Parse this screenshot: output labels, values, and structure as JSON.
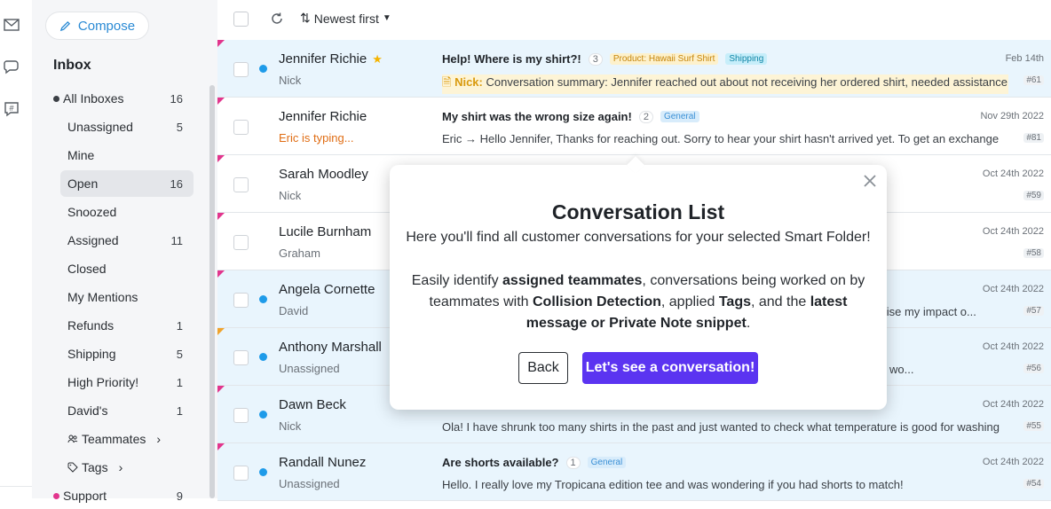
{
  "sidebar": {
    "compose_label": "Compose",
    "inbox_title": "Inbox",
    "items": [
      {
        "label": "All Inboxes",
        "count": "16"
      },
      {
        "label": "Unassigned",
        "count": "5"
      },
      {
        "label": "Mine",
        "count": ""
      },
      {
        "label": "Open",
        "count": "16"
      },
      {
        "label": "Snoozed",
        "count": ""
      },
      {
        "label": "Assigned",
        "count": "11"
      },
      {
        "label": "Closed",
        "count": ""
      },
      {
        "label": "My Mentions",
        "count": ""
      },
      {
        "label": "Refunds",
        "count": "1"
      },
      {
        "label": "Shipping",
        "count": "5"
      },
      {
        "label": "High Priority!",
        "count": "1"
      },
      {
        "label": "David's",
        "count": "1"
      },
      {
        "label": "Teammates",
        "count": ""
      },
      {
        "label": "Tags",
        "count": ""
      },
      {
        "label": "Support",
        "count": "9"
      }
    ]
  },
  "toolbar": {
    "sort_label": "Newest first"
  },
  "conversations": [
    {
      "name": "Jennifer Richie",
      "assignee": "Nick",
      "subject": "Help! Where is my shirt?!",
      "msg_count": "3",
      "tags": [
        "Product: Hawaii Surf Shirt",
        "Shipping"
      ],
      "note_author": "Nick:",
      "preview": "Conversation summary: Jennifer reached out about not receiving her ordered shirt, needed assistance",
      "date": "Feb 14th",
      "num": "#61"
    },
    {
      "name": "Jennifer Richie",
      "assignee": "Eric is typing...",
      "subject": "My shirt was the wrong size again!",
      "msg_count": "2",
      "tags": [
        "General"
      ],
      "preview": "Eric → Hello Jennifer,   Thanks for reaching out.   Sorry to hear your shirt hasn't arrived yet.  To get an exchange",
      "date": "Nov 29th 2022",
      "num": "#81"
    },
    {
      "name": "Sarah Moodley",
      "assignee": "Nick",
      "date": "Oct 24th 2022",
      "num": "#59"
    },
    {
      "name": "Lucile Burnham",
      "assignee": "Graham",
      "date": "Oct 24th 2022",
      "num": "#58"
    },
    {
      "name": "Angela Cornette",
      "assignee": "David",
      "preview_tail": "imise my impact o...",
      "date": "Oct 24th 2022",
      "num": "#57"
    },
    {
      "name": "Anthony Marshall",
      "assignee": "Unassigned",
      "preview_tail": "wo...",
      "date": "Oct 24th 2022",
      "num": "#56"
    },
    {
      "name": "Dawn Beck",
      "assignee": "Nick",
      "preview": "Ola! I have shrunk too many shirts in the past and just wanted to check what temperature is good for washing",
      "date": "Oct 24th 2022",
      "num": "#55"
    },
    {
      "name": "Randall Nunez",
      "assignee": "Unassigned",
      "subject": "Are shorts available?",
      "msg_count": "1",
      "tags": [
        "General"
      ],
      "preview": "Hello. I really love my Tropicana edition tee and was wondering if you had shorts to match!",
      "date": "Oct 24th 2022",
      "num": "#54"
    }
  ],
  "popover": {
    "title": "Conversation List",
    "line1": "Here you'll find all customer conversations for your selected Smart Folder!",
    "body_1": "Easily identify ",
    "body_b1": "assigned teammates",
    "body_2": ", conversations being worked on by teammates with ",
    "body_b2": "Collision Detection",
    "body_3": ", applied ",
    "body_b3": "Tags",
    "body_4": ", and the ",
    "body_b4": "latest message or Private Note snippet",
    "body_5": ".",
    "back_label": "Back",
    "primary_label": "Let's see a conversation!"
  },
  "colors": {
    "accent": "#5b34f1",
    "unread_bg": "#e9f5fd",
    "unread_dot": "#1e9be9",
    "priority_flag": "#e2358d"
  }
}
